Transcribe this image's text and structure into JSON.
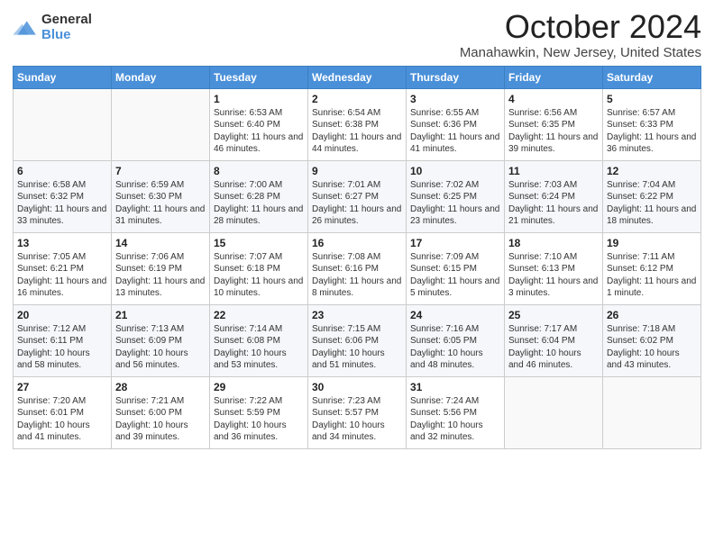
{
  "logo": {
    "general": "General",
    "blue": "Blue"
  },
  "header": {
    "title": "October 2024",
    "location": "Manahawkin, New Jersey, United States"
  },
  "columns": [
    "Sunday",
    "Monday",
    "Tuesday",
    "Wednesday",
    "Thursday",
    "Friday",
    "Saturday"
  ],
  "weeks": [
    [
      {
        "day": "",
        "content": ""
      },
      {
        "day": "",
        "content": ""
      },
      {
        "day": "1",
        "content": "Sunrise: 6:53 AM\nSunset: 6:40 PM\nDaylight: 11 hours and 46 minutes."
      },
      {
        "day": "2",
        "content": "Sunrise: 6:54 AM\nSunset: 6:38 PM\nDaylight: 11 hours and 44 minutes."
      },
      {
        "day": "3",
        "content": "Sunrise: 6:55 AM\nSunset: 6:36 PM\nDaylight: 11 hours and 41 minutes."
      },
      {
        "day": "4",
        "content": "Sunrise: 6:56 AM\nSunset: 6:35 PM\nDaylight: 11 hours and 39 minutes."
      },
      {
        "day": "5",
        "content": "Sunrise: 6:57 AM\nSunset: 6:33 PM\nDaylight: 11 hours and 36 minutes."
      }
    ],
    [
      {
        "day": "6",
        "content": "Sunrise: 6:58 AM\nSunset: 6:32 PM\nDaylight: 11 hours and 33 minutes."
      },
      {
        "day": "7",
        "content": "Sunrise: 6:59 AM\nSunset: 6:30 PM\nDaylight: 11 hours and 31 minutes."
      },
      {
        "day": "8",
        "content": "Sunrise: 7:00 AM\nSunset: 6:28 PM\nDaylight: 11 hours and 28 minutes."
      },
      {
        "day": "9",
        "content": "Sunrise: 7:01 AM\nSunset: 6:27 PM\nDaylight: 11 hours and 26 minutes."
      },
      {
        "day": "10",
        "content": "Sunrise: 7:02 AM\nSunset: 6:25 PM\nDaylight: 11 hours and 23 minutes."
      },
      {
        "day": "11",
        "content": "Sunrise: 7:03 AM\nSunset: 6:24 PM\nDaylight: 11 hours and 21 minutes."
      },
      {
        "day": "12",
        "content": "Sunrise: 7:04 AM\nSunset: 6:22 PM\nDaylight: 11 hours and 18 minutes."
      }
    ],
    [
      {
        "day": "13",
        "content": "Sunrise: 7:05 AM\nSunset: 6:21 PM\nDaylight: 11 hours and 16 minutes."
      },
      {
        "day": "14",
        "content": "Sunrise: 7:06 AM\nSunset: 6:19 PM\nDaylight: 11 hours and 13 minutes."
      },
      {
        "day": "15",
        "content": "Sunrise: 7:07 AM\nSunset: 6:18 PM\nDaylight: 11 hours and 10 minutes."
      },
      {
        "day": "16",
        "content": "Sunrise: 7:08 AM\nSunset: 6:16 PM\nDaylight: 11 hours and 8 minutes."
      },
      {
        "day": "17",
        "content": "Sunrise: 7:09 AM\nSunset: 6:15 PM\nDaylight: 11 hours and 5 minutes."
      },
      {
        "day": "18",
        "content": "Sunrise: 7:10 AM\nSunset: 6:13 PM\nDaylight: 11 hours and 3 minutes."
      },
      {
        "day": "19",
        "content": "Sunrise: 7:11 AM\nSunset: 6:12 PM\nDaylight: 11 hours and 1 minute."
      }
    ],
    [
      {
        "day": "20",
        "content": "Sunrise: 7:12 AM\nSunset: 6:11 PM\nDaylight: 10 hours and 58 minutes."
      },
      {
        "day": "21",
        "content": "Sunrise: 7:13 AM\nSunset: 6:09 PM\nDaylight: 10 hours and 56 minutes."
      },
      {
        "day": "22",
        "content": "Sunrise: 7:14 AM\nSunset: 6:08 PM\nDaylight: 10 hours and 53 minutes."
      },
      {
        "day": "23",
        "content": "Sunrise: 7:15 AM\nSunset: 6:06 PM\nDaylight: 10 hours and 51 minutes."
      },
      {
        "day": "24",
        "content": "Sunrise: 7:16 AM\nSunset: 6:05 PM\nDaylight: 10 hours and 48 minutes."
      },
      {
        "day": "25",
        "content": "Sunrise: 7:17 AM\nSunset: 6:04 PM\nDaylight: 10 hours and 46 minutes."
      },
      {
        "day": "26",
        "content": "Sunrise: 7:18 AM\nSunset: 6:02 PM\nDaylight: 10 hours and 43 minutes."
      }
    ],
    [
      {
        "day": "27",
        "content": "Sunrise: 7:20 AM\nSunset: 6:01 PM\nDaylight: 10 hours and 41 minutes."
      },
      {
        "day": "28",
        "content": "Sunrise: 7:21 AM\nSunset: 6:00 PM\nDaylight: 10 hours and 39 minutes."
      },
      {
        "day": "29",
        "content": "Sunrise: 7:22 AM\nSunset: 5:59 PM\nDaylight: 10 hours and 36 minutes."
      },
      {
        "day": "30",
        "content": "Sunrise: 7:23 AM\nSunset: 5:57 PM\nDaylight: 10 hours and 34 minutes."
      },
      {
        "day": "31",
        "content": "Sunrise: 7:24 AM\nSunset: 5:56 PM\nDaylight: 10 hours and 32 minutes."
      },
      {
        "day": "",
        "content": ""
      },
      {
        "day": "",
        "content": ""
      }
    ]
  ]
}
